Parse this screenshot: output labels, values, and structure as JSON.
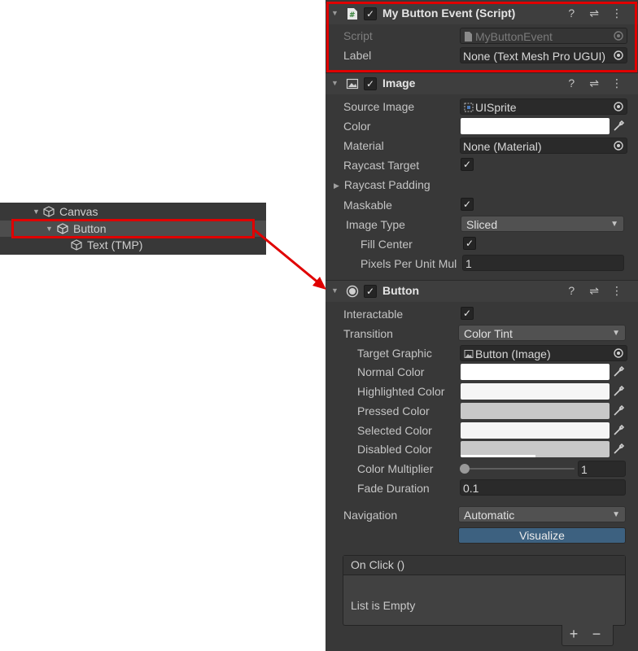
{
  "hierarchy": {
    "items": [
      {
        "label": "Canvas"
      },
      {
        "label": "Button"
      },
      {
        "label": "Text (TMP)"
      }
    ]
  },
  "components": {
    "script": {
      "title": "My Button Event (Script)",
      "script_label": "Script",
      "script_value": "MyButtonEvent",
      "label_label": "Label",
      "label_value": "None (Text Mesh Pro UGUI)"
    },
    "image": {
      "title": "Image",
      "source_image_label": "Source Image",
      "source_image_value": "UISprite",
      "color_label": "Color",
      "material_label": "Material",
      "material_value": "None (Material)",
      "raycast_target_label": "Raycast Target",
      "raycast_padding_label": "Raycast Padding",
      "maskable_label": "Maskable",
      "image_type_label": "Image Type",
      "image_type_value": "Sliced",
      "fill_center_label": "Fill Center",
      "ppu_label": "Pixels Per Unit Mul",
      "ppu_value": "1"
    },
    "button": {
      "title": "Button",
      "interactable_label": "Interactable",
      "transition_label": "Transition",
      "transition_value": "Color Tint",
      "target_graphic_label": "Target Graphic",
      "target_graphic_value": "Button (Image)",
      "normal_color_label": "Normal Color",
      "highlighted_color_label": "Highlighted Color",
      "pressed_color_label": "Pressed Color",
      "selected_color_label": "Selected Color",
      "disabled_color_label": "Disabled Color",
      "color_multiplier_label": "Color Multiplier",
      "color_multiplier_value": "1",
      "color_multiplier_fraction": 0,
      "fade_duration_label": "Fade Duration",
      "fade_duration_value": "0.1",
      "navigation_label": "Navigation",
      "navigation_value": "Automatic",
      "visualize_label": "Visualize",
      "onclick_title": "On Click ()",
      "onclick_empty": "List is Empty",
      "add_label": "+",
      "remove_label": "−"
    }
  },
  "header_icons": {
    "help": "?",
    "preset": "⇌",
    "menu": "⋮"
  },
  "colors": {
    "highlight": "#e00000",
    "panel_bg": "#383838",
    "header_bg": "#3e3e3e",
    "image_color": "#ffffff",
    "normal_color": "#ffffff",
    "highlighted_color": "#f5f5f5",
    "pressed_color": "#c8c8c8",
    "selected_color": "#f5f5f5",
    "disabled_color": "#c8c8c8"
  }
}
